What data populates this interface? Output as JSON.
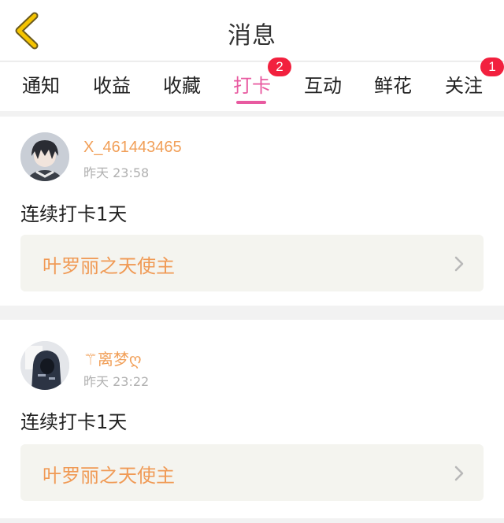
{
  "header": {
    "title": "消息",
    "back_icon": "chevron-left-icon",
    "back_color": "#f5c400"
  },
  "tabs": [
    {
      "label": "通知",
      "active": false
    },
    {
      "label": "收益",
      "active": false
    },
    {
      "label": "收藏",
      "active": false
    },
    {
      "label": "打卡",
      "active": true,
      "badge": "2"
    },
    {
      "label": "互动",
      "active": false
    },
    {
      "label": "鲜花",
      "active": false
    },
    {
      "label": "关注",
      "active": false,
      "badge": "1"
    }
  ],
  "colors": {
    "accent_pink": "#e85aa0",
    "badge_red": "#f2203e",
    "username_orange": "#f19f58",
    "link_orange": "#f09a55"
  },
  "messages": [
    {
      "username": "X_461443465",
      "time": "昨天 23:58",
      "text": "连续打卡1天",
      "link_text": "叶罗丽之天使主",
      "avatar_icon": "anime-avatar-icon"
    },
    {
      "username": "⚚离梦ღ",
      "time": "昨天 23:22",
      "text": "连续打卡1天",
      "link_text": "叶罗丽之天使主",
      "avatar_icon": "hooded-figure-avatar-icon"
    }
  ]
}
